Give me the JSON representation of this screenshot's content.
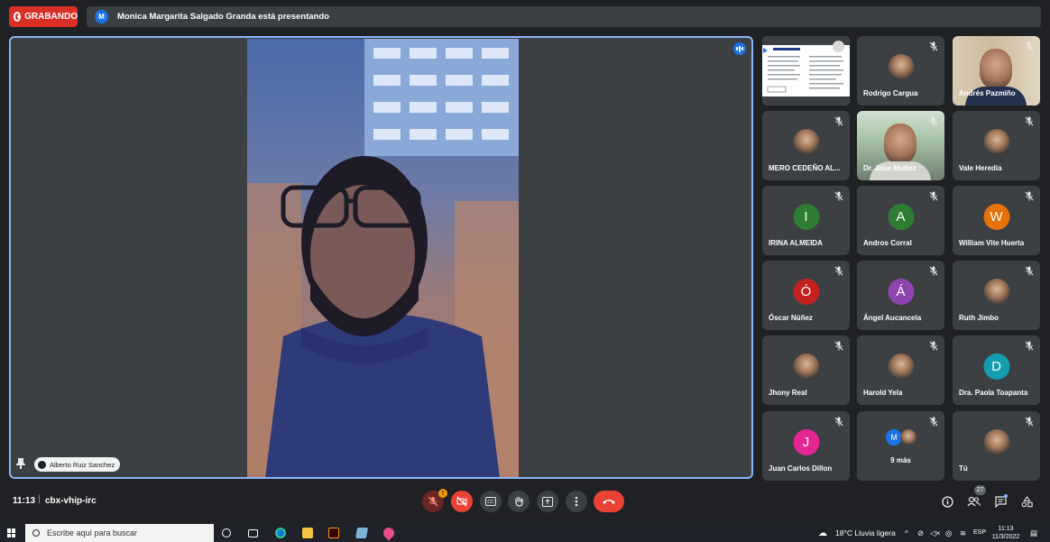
{
  "recording": {
    "label": "GRABANDO"
  },
  "presenter_bar": {
    "avatar_letter": "M",
    "text": "Monica Margarita Salgado Granda está presentando"
  },
  "main_speaker": {
    "name": "Alberto Ruiz Sanchez"
  },
  "participants": [
    {
      "name": "",
      "type": "presentation"
    },
    {
      "name": "Rodrigo Cargua",
      "type": "photo"
    },
    {
      "name": "Andrés Pazmiño",
      "type": "video"
    },
    {
      "name": "MERO CEDEÑO AL...",
      "type": "photo"
    },
    {
      "name": "Dr. Jose Muñoz",
      "type": "video"
    },
    {
      "name": "Vale Heredia",
      "type": "photo"
    },
    {
      "name": "IRINA ALMEIDA",
      "type": "letter",
      "letter": "I",
      "color": "#2e7d32"
    },
    {
      "name": "Andros Corral",
      "type": "letter",
      "letter": "A",
      "color": "#2e7d32"
    },
    {
      "name": "William Vite Huerta",
      "type": "letter",
      "letter": "W",
      "color": "#e8710a"
    },
    {
      "name": "Óscar Núñez",
      "type": "letter",
      "letter": "Ó",
      "color": "#c5221f"
    },
    {
      "name": "Ángel Aucancela",
      "type": "letter",
      "letter": "Á",
      "color": "#8e44ad"
    },
    {
      "name": "Ruth Jimbo",
      "type": "photo"
    },
    {
      "name": "Jhony Real",
      "type": "photo"
    },
    {
      "name": "Harold Yela",
      "type": "photo"
    },
    {
      "name": "Dra. Paola Toapanta",
      "type": "letter",
      "letter": "D",
      "color": "#129eaf"
    },
    {
      "name": "Juan Carlos Dillon",
      "type": "letter",
      "letter": "J",
      "color": "#e52592"
    },
    {
      "name": "9 más",
      "type": "more",
      "letter": "M"
    },
    {
      "name": "Tú",
      "type": "photo"
    }
  ],
  "bottom_bar": {
    "time": "11:13",
    "separator": "|",
    "meeting_code": "cbx-vhip-irc",
    "mic_warning": "!",
    "people_count": "27"
  },
  "taskbar": {
    "search_placeholder": "Escribe aquí para buscar",
    "weather": "18°C  Lluvia ligera",
    "language": "ESP",
    "clock_time": "11:13",
    "clock_date": "11/3/2022"
  },
  "colors": {
    "accent": "#8ab4f8",
    "danger": "#ea4335",
    "record": "#d93025"
  }
}
